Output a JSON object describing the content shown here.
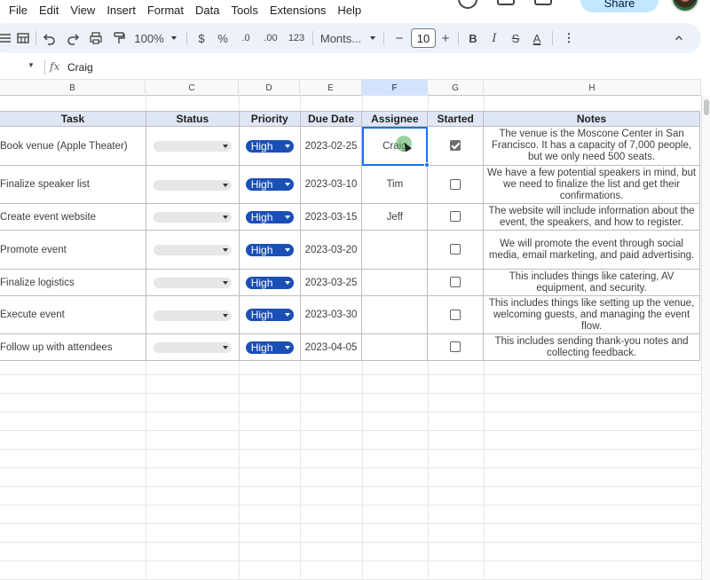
{
  "menu": [
    "File",
    "Edit",
    "View",
    "Insert",
    "Format",
    "Data",
    "Tools",
    "Extensions",
    "Help"
  ],
  "topbar": {
    "share_label": "Share"
  },
  "toolbar": {
    "zoom": "100%",
    "currency": "$",
    "percent": "%",
    "decrease_decimal": ".0",
    "increase_decimal": ".00",
    "number_format": "123",
    "font": "Monts...",
    "font_size": "10",
    "minus": "−",
    "plus": "+",
    "bold": "B",
    "italic": "I",
    "strike": "S",
    "text_color": "A",
    "more": "⋮",
    "collapse": "^"
  },
  "formula_bar": {
    "fx": "fx",
    "value": "Craig"
  },
  "columns": [
    "B",
    "C",
    "D",
    "E",
    "F",
    "G",
    "H"
  ],
  "selected_column": "F",
  "table": {
    "headers": [
      "Task",
      "Status",
      "Priority",
      "Due Date",
      "Assignee",
      "Started",
      "Notes"
    ],
    "rows": [
      {
        "task": "Book venue (Apple Theater)",
        "priority": "High",
        "due": "2023-02-25",
        "assignee": "Craig",
        "started": true,
        "notes": "The venue is the Moscone Center in San Francisco. It has a capacity of 7,000 people, but we only need 500 seats."
      },
      {
        "task": "Finalize speaker list",
        "priority": "High",
        "due": "2023-03-10",
        "assignee": "Tim",
        "started": false,
        "notes": "We have a few potential speakers in mind, but we need to finalize the list and get their confirmations."
      },
      {
        "task": "Create event website",
        "priority": "High",
        "due": "2023-03-15",
        "assignee": "Jeff",
        "started": false,
        "notes": "The website will include information about the event, the speakers, and how to register."
      },
      {
        "task": "Promote event",
        "priority": "High",
        "due": "2023-03-20",
        "assignee": "",
        "started": false,
        "notes": "We will promote the event through social media, email marketing, and paid advertising."
      },
      {
        "task": "Finalize logistics",
        "priority": "High",
        "due": "2023-03-25",
        "assignee": "",
        "started": false,
        "notes": "This includes things like catering, AV equipment, and security."
      },
      {
        "task": "Execute event",
        "priority": "High",
        "due": "2023-03-30",
        "assignee": "",
        "started": false,
        "notes": "This includes things like setting up the venue, welcoming guests, and managing the event flow."
      },
      {
        "task": "Follow up with attendees",
        "priority": "High",
        "due": "2023-04-05",
        "assignee": "",
        "started": false,
        "notes": "This includes sending thank-you notes and collecting feedback."
      }
    ]
  },
  "colors": {
    "priority_chip": "#1a50b6",
    "header_fill": "#dfe6f5",
    "selection": "#1a73e8"
  }
}
